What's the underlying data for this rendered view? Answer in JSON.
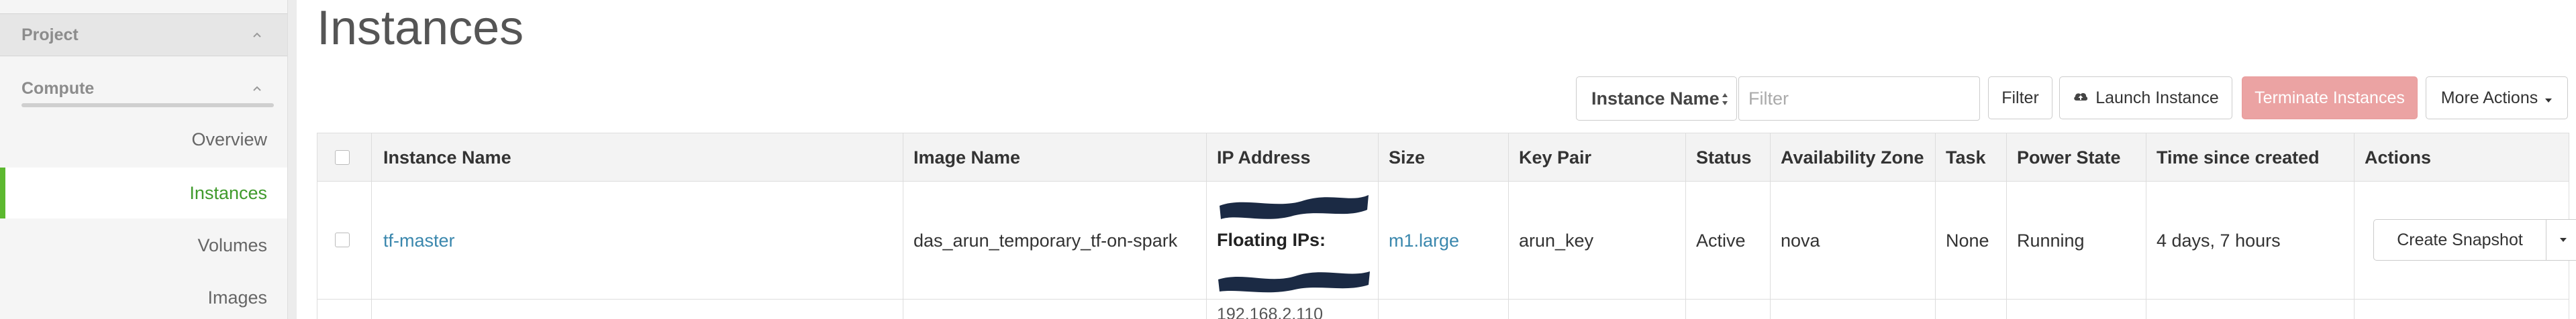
{
  "sidebar": {
    "project_label": "Project",
    "compute_label": "Compute",
    "items": [
      {
        "label": "Overview"
      },
      {
        "label": "Instances",
        "active": true
      },
      {
        "label": "Volumes"
      },
      {
        "label": "Images"
      }
    ]
  },
  "page": {
    "title": "Instances"
  },
  "toolbar": {
    "filter_field_selected": "Instance Name",
    "filter_placeholder": "Filter",
    "filter_button": "Filter",
    "launch_button": "Launch Instance",
    "launch_icon": "cloud-upload-icon",
    "terminate_button": "Terminate Instances",
    "more_actions_button": "More Actions"
  },
  "table": {
    "columns": [
      "Instance Name",
      "Image Name",
      "IP Address",
      "Size",
      "Key Pair",
      "Status",
      "Availability Zone",
      "Task",
      "Power State",
      "Time since created",
      "Actions"
    ],
    "rows": [
      {
        "instance_name": "tf-master",
        "image_name": "das_arun_temporary_tf-on-spark",
        "floating_ips_label": "Floating IPs:",
        "size": "m1.large",
        "key_pair": "arun_key",
        "status": "Active",
        "availability_zone": "nova",
        "task": "None",
        "power_state": "Running",
        "time_since_created": "4 days, 7 hours",
        "action": "Create Snapshot"
      }
    ],
    "next_row_ip_partial": "192.168.2.110"
  },
  "colors": {
    "active_nav": "#3f9a2b",
    "link": "#3a87ad",
    "danger_disabled": "#eba3a3",
    "redaction": "#1b2a44"
  }
}
